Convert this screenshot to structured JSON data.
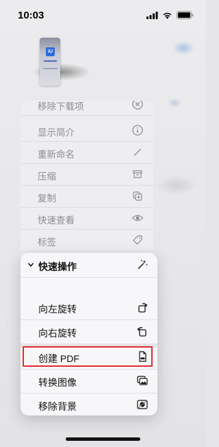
{
  "status_bar": {
    "time": "10:03"
  },
  "thumbnail": {
    "logo_text": "iU"
  },
  "upper_menu": {
    "items": [
      {
        "label": "移除下载项",
        "icon": "xmark-circle-icon"
      },
      {
        "label": "显示简介",
        "icon": "info-circle-icon"
      },
      {
        "label": "重新命名",
        "icon": "pencil-icon"
      },
      {
        "label": "压缩",
        "icon": "archive-box-icon"
      },
      {
        "label": "复制",
        "icon": "duplicate-icon"
      },
      {
        "label": "快速查看",
        "icon": "eye-icon"
      },
      {
        "label": "标签",
        "icon": "tag-icon"
      }
    ]
  },
  "quick_actions": {
    "title": "快速操作",
    "items": [
      {
        "label": "向左旋转",
        "icon": "rotate-left-icon"
      },
      {
        "label": "向右旋转",
        "icon": "rotate-right-icon"
      },
      {
        "label": "创建 PDF",
        "icon": "pdf-document-icon"
      },
      {
        "label": "转换图像",
        "icon": "convert-image-icon"
      },
      {
        "label": "移除背景",
        "icon": "remove-background-icon"
      }
    ]
  },
  "colors": {
    "highlight": "#e12b2b",
    "menu_text": "#111111",
    "dimmed_text": "#8e8e93"
  }
}
